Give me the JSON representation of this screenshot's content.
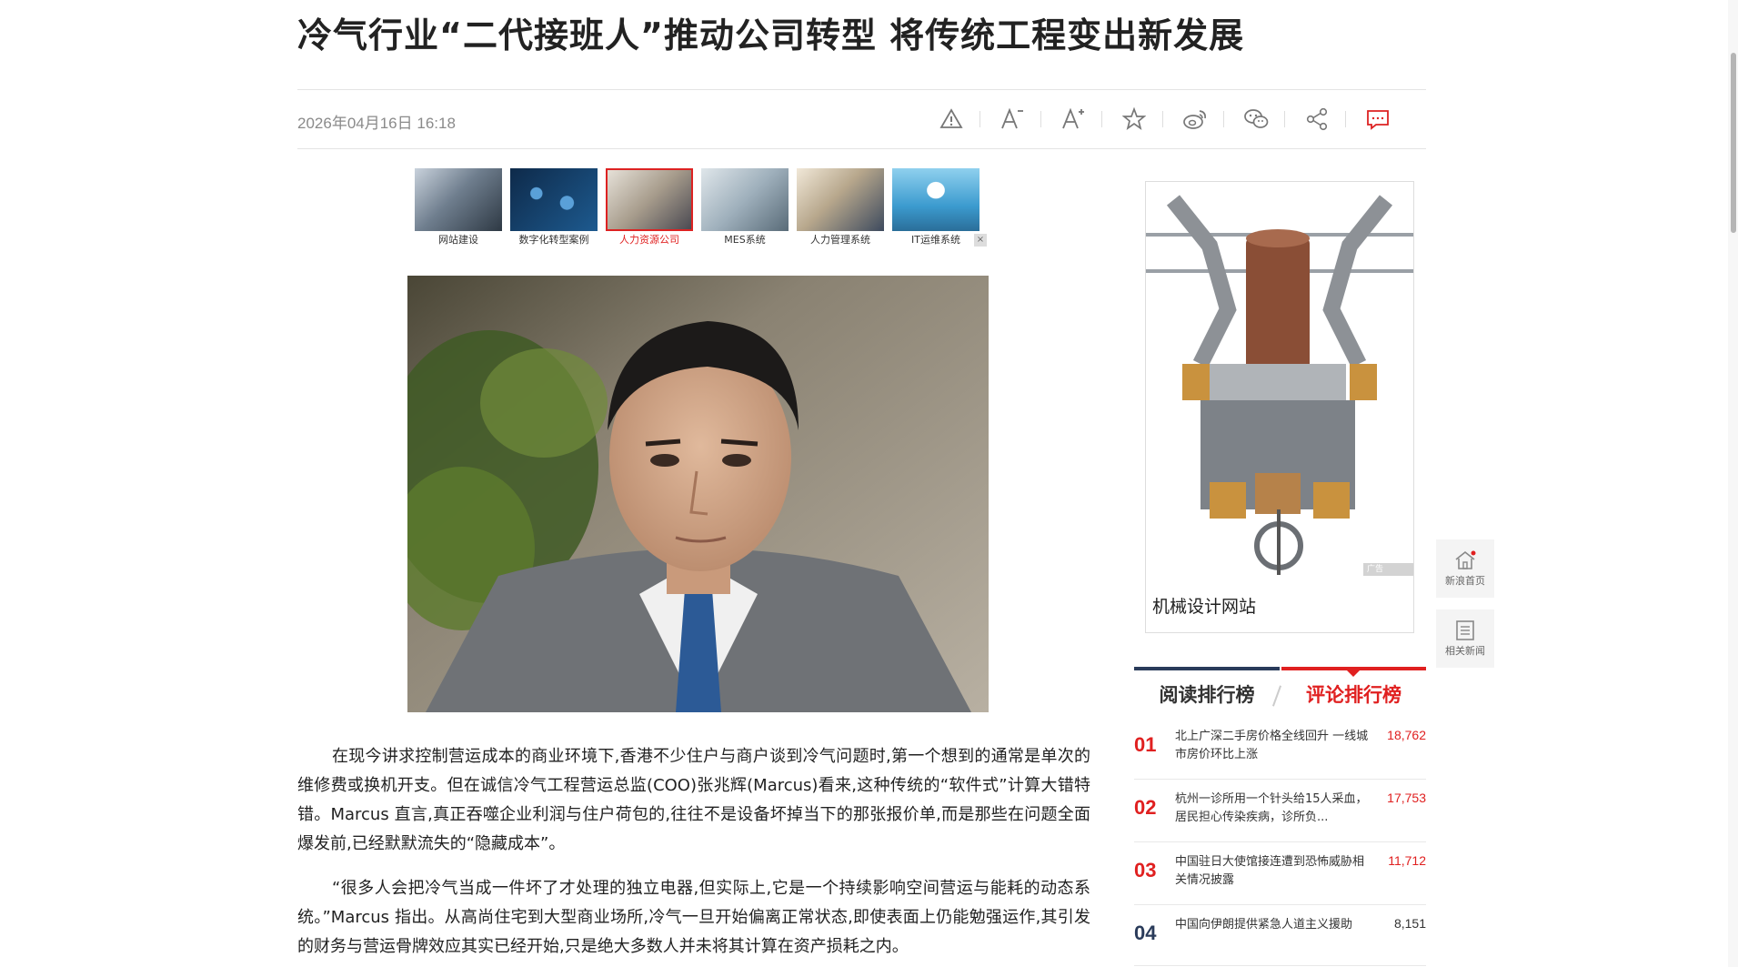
{
  "article": {
    "title": "冷气行业“二代接班人”推动公司转型 将传统工程变出新发展",
    "date": "2026年04月16日 16:18",
    "paragraphs": [
      "在现今讲求控制营运成本的商业环境下,香港不少住户与商户谈到冷气问题时,第一个想到的通常是单次的维修费或换机开支。但在诚信冷气工程营运总监(COO)张兆辉(Marcus)看来,这种传统的“软件式”计算大错特错。Marcus 直言,真正吞噬企业利润与住户荷包的,往往不是设备坏掉当下的那张报价单,而是那些在问题全面爆发前,已经默默流失的“隐藏成本”。",
      "“很多人会把冷气当成一件坏了才处理的独立电器,但实际上,它是一个持续影响空间营运与能耗的动态系统。”Marcus 指出。从高尚住宅到大型商业场所,冷气一旦开始偏离正常状态,即使表面上仍能勉强运作,其引发的财务与营运骨牌效应其实已经开始,只是绝大多数人并未将其计算在资产损耗之内。"
    ]
  },
  "toolbar": {
    "icons": [
      "report-icon",
      "font-decrease-icon",
      "font-increase-icon",
      "favorite-icon",
      "weibo-icon",
      "wechat-icon",
      "share-icon",
      "comment-icon"
    ]
  },
  "ad_strip": {
    "items": [
      {
        "label": "网站建设",
        "selected": false
      },
      {
        "label": "数字化转型案例",
        "selected": false
      },
      {
        "label": "人力资源公司",
        "selected": true
      },
      {
        "label": "MES系统",
        "selected": false
      },
      {
        "label": "人力管理系统",
        "selected": false
      },
      {
        "label": "IT运维系统",
        "selected": false
      }
    ],
    "close": "×"
  },
  "side_ad": {
    "caption": "机械设计网站",
    "tag": "广告"
  },
  "ranking": {
    "tabs": [
      "阅读排行榜",
      "评论排行榜"
    ],
    "active_tab": 1,
    "accent_color": "#e02020",
    "dark_color": "#2a3b5a",
    "items": [
      {
        "num": "01",
        "title": "北上广深二手房价格全线回升 一线城市房价环比上涨",
        "count": "18,762"
      },
      {
        "num": "02",
        "title": "杭州一诊所用一个针头给15人采血，居民担心传染疾病，诊所负...",
        "count": "17,753"
      },
      {
        "num": "03",
        "title": "中国驻日大使馆接连遭到恐怖威胁相关情况披露",
        "count": "11,712"
      },
      {
        "num": "04",
        "title": "中国向伊朗提供紧急人道主义援助",
        "count": "8,151"
      }
    ]
  },
  "side_nav": {
    "home": "新浪首页",
    "related": "相关新闻"
  }
}
